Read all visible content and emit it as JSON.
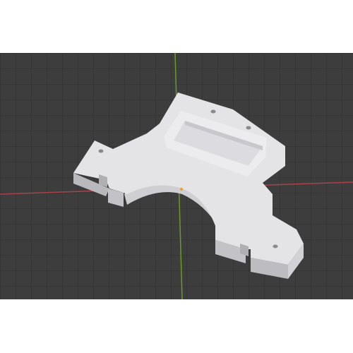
{
  "viewport": {
    "background_color": "#3d3d3d",
    "grid_color": "#363636",
    "x_axis_color": "#a8434b",
    "y_axis_color": "#6b9a2a",
    "model_color": "#e4e4e6",
    "model_shadow_color": "#b9b9bd",
    "origin_marker_color": "#f0a020"
  },
  "scene": {
    "object": "mount-bracket-model",
    "visible_text": []
  }
}
